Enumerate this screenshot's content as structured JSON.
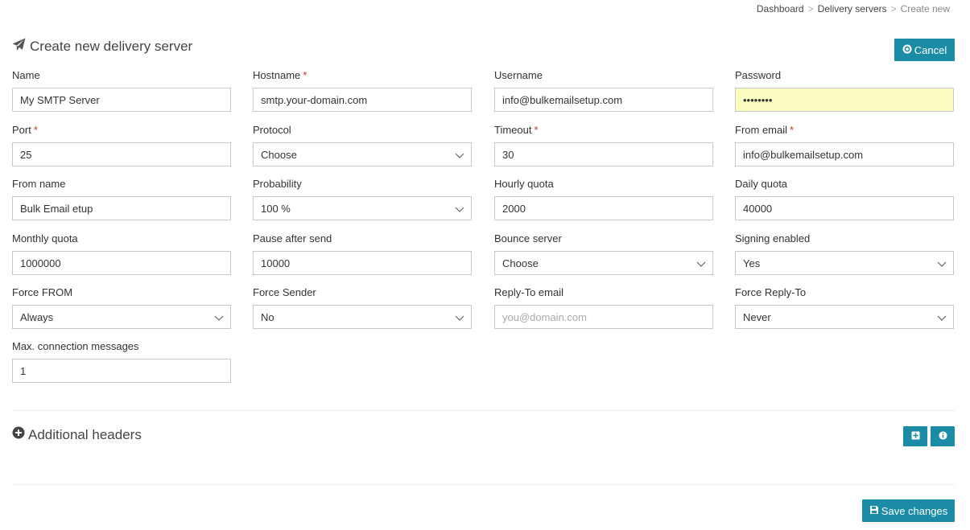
{
  "breadcrumb": {
    "items": [
      "Dashboard",
      "Delivery servers"
    ],
    "current": "Create new",
    "separator": ">"
  },
  "page": {
    "title": "Create new delivery server",
    "title_icon": "paper-plane-icon",
    "cancel_label": "Cancel",
    "cancel_icon": "circle-x-icon"
  },
  "form": {
    "name": {
      "label": "Name",
      "value": "My SMTP Server"
    },
    "hostname": {
      "label": "Hostname",
      "required": "*",
      "value": "smtp.your-domain.com"
    },
    "username": {
      "label": "Username",
      "value": "info@bulkemailsetup.com"
    },
    "password": {
      "label": "Password",
      "value": "••••••••"
    },
    "port": {
      "label": "Port",
      "required": "*",
      "value": "25"
    },
    "protocol": {
      "label": "Protocol",
      "value": "Choose"
    },
    "timeout": {
      "label": "Timeout",
      "required": "*",
      "value": "30"
    },
    "from_email": {
      "label": "From email",
      "required": "*",
      "value": "info@bulkemailsetup.com"
    },
    "from_name": {
      "label": "From name",
      "value": "Bulk Email etup"
    },
    "probability": {
      "label": "Probability",
      "value": "100 %"
    },
    "hourly_quota": {
      "label": "Hourly quota",
      "value": "2000"
    },
    "daily_quota": {
      "label": "Daily quota",
      "value": "40000"
    },
    "monthly_quota": {
      "label": "Monthly quota",
      "value": "1000000"
    },
    "pause_after_send": {
      "label": "Pause after send",
      "value": "10000"
    },
    "bounce_server": {
      "label": "Bounce server",
      "value": "Choose"
    },
    "signing_enabled": {
      "label": "Signing enabled",
      "value": "Yes"
    },
    "force_from": {
      "label": "Force FROM",
      "value": "Always"
    },
    "force_sender": {
      "label": "Force Sender",
      "value": "No"
    },
    "reply_to_email": {
      "label": "Reply-To email",
      "placeholder": "you@domain.com",
      "value": ""
    },
    "force_reply_to": {
      "label": "Force Reply-To",
      "value": "Never"
    },
    "max_connection_messages": {
      "label": "Max. connection messages",
      "value": "1"
    }
  },
  "additional_headers": {
    "title": "Additional headers",
    "icon": "plus-circle-icon",
    "add_icon": "plus-square-icon",
    "info_icon": "info-circle-icon"
  },
  "footer": {
    "save_label": "Save changes",
    "save_icon": "floppy-disk-icon"
  },
  "colors": {
    "accent": "#1b8ca6",
    "required": "#c0392b",
    "autofill": "#fafcc0"
  }
}
